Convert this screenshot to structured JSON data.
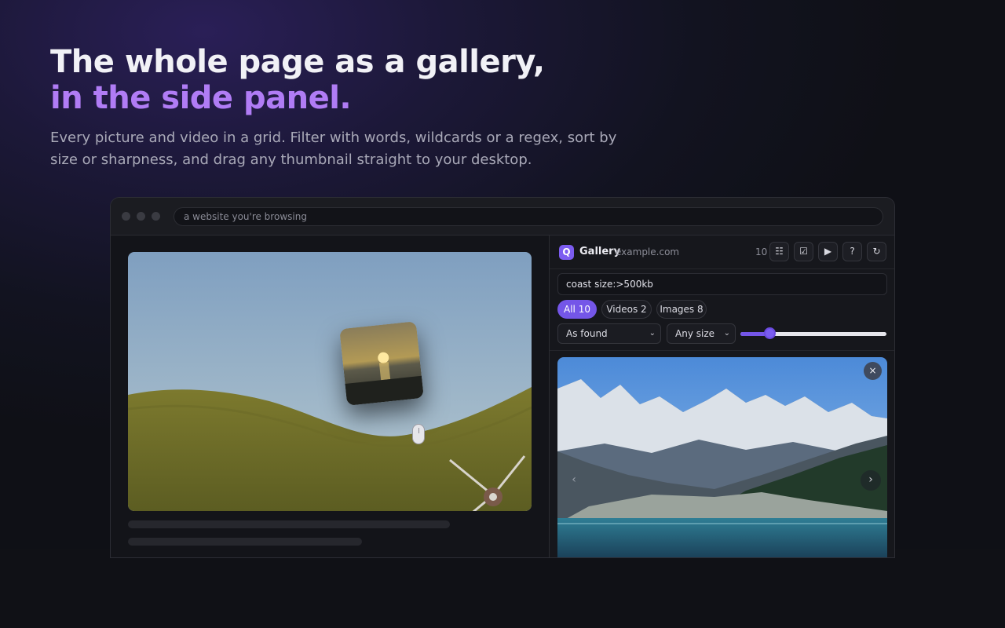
{
  "hero": {
    "line1": "The whole page as a gallery,",
    "line2": "in the side panel.",
    "subcopy": "Every picture and video in a grid. Filter with words, wildcards or a regex, sort by size or sharpness, and drag any thumbnail straight to your desktop."
  },
  "browser": {
    "url_text": "a website you're browsing"
  },
  "panel": {
    "logo_glyph": "Q",
    "title": "Gallery",
    "domain": "example.com",
    "count": "10",
    "tools": {
      "list_icon": "☷",
      "select_icon": "☑",
      "play_icon": "▶",
      "help_icon": "?",
      "refresh_icon": "↻"
    },
    "search_value": "coast size:>500kb",
    "filters": [
      {
        "label": "All 10",
        "active": true
      },
      {
        "label": "Videos 2",
        "active": false
      },
      {
        "label": "Images 8",
        "active": false
      }
    ],
    "sort_select": "As found",
    "size_select": "Any size",
    "thumb_size_slider": 0.2,
    "close_glyph": "×",
    "prev_glyph": "‹",
    "next_glyph": "›"
  },
  "colors": {
    "accent": "#7456e8",
    "headline_accent": "#b07cf5"
  }
}
